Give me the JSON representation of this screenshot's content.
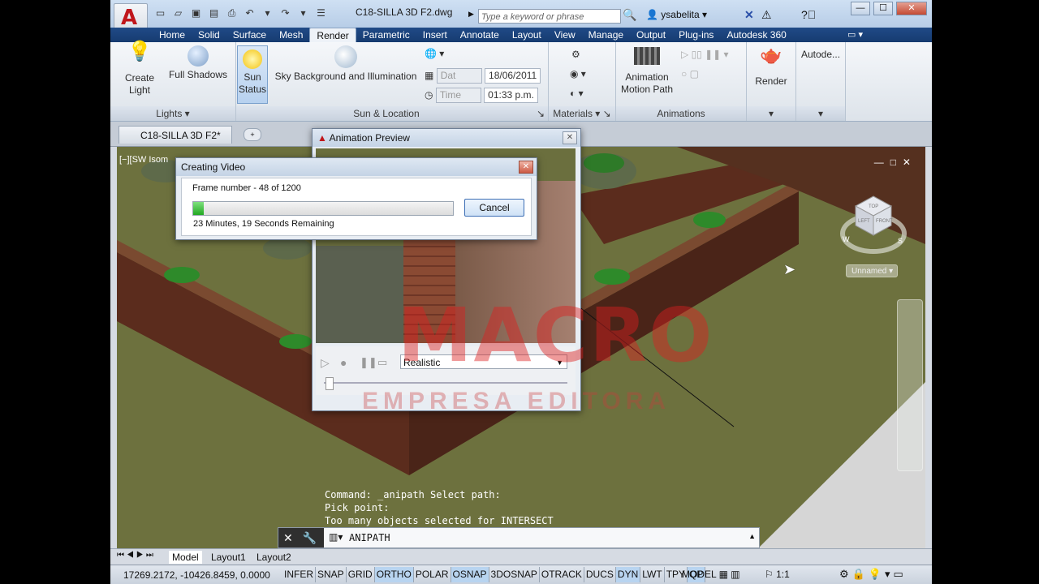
{
  "window": {
    "doc_title": "C18-SILLA 3D F2.dwg",
    "search_placeholder": "Type a keyword or phrase",
    "user": "ysabelita",
    "min": "—",
    "max": "☐",
    "close": "✕"
  },
  "ribbon_tabs": [
    "Home",
    "Solid",
    "Surface",
    "Mesh",
    "Render",
    "Parametric",
    "Insert",
    "Annotate",
    "Layout",
    "View",
    "Manage",
    "Output",
    "Plug-ins",
    "Autodesk 360"
  ],
  "active_tab": "Render",
  "ribbon": {
    "lights": {
      "create_light": "Create\nLight",
      "full_shadows": "Full Shadows",
      "label": "Lights"
    },
    "sun": {
      "sun_status": "Sun\nStatus",
      "sky": "Sky Background and Illumination",
      "date_label": "Dat",
      "date_value": "18/06/2011",
      "time_label": "Time",
      "time_value": "01:33 p.m.",
      "label": "Sun & Location"
    },
    "materials": {
      "label": "Materials"
    },
    "animations": {
      "motion_path": "Animation\nMotion Path",
      "label": "Animations"
    },
    "render": {
      "render": "Render",
      "autodesk": "Autode..."
    }
  },
  "doc_tab": {
    "name": "C18-SILLA 3D F2*"
  },
  "viewport": {
    "label": "[−][SW Isom",
    "view_name": "Unnamed"
  },
  "viewcube": {
    "top": "TOP",
    "left": "LEFT",
    "front": "FRONT",
    "w": "W",
    "s": "S"
  },
  "command_history": [
    "Command: _anipath Select path:",
    "Pick point:",
    "Too many objects selected for INTERSECT"
  ],
  "command_input": "ANIPATH",
  "layout_tabs": [
    "Model",
    "Layout1",
    "Layout2"
  ],
  "status": {
    "coords": "17269.2172, -10426.8459, 0.0000",
    "toggles": [
      "INFER",
      "SNAP",
      "GRID",
      "ORTHO",
      "POLAR",
      "OSNAP",
      "3DOSNAP",
      "OTRACK",
      "DUCS",
      "DYN",
      "LWT",
      "TPY",
      "QP"
    ],
    "toggles_on": [
      "ORTHO",
      "OSNAP",
      "DYN",
      "QP"
    ],
    "model": "MODEL",
    "scale": "1:1"
  },
  "animation_preview": {
    "title": "Animation Preview",
    "visual_style": "Realistic"
  },
  "creating_video": {
    "title": "Creating Video",
    "frame_text": "Frame number - 48 of 1200",
    "progress": 0.04,
    "remaining": "23 Minutes, 19 Seconds Remaining",
    "cancel": "Cancel"
  },
  "watermark": {
    "main": "MACRO",
    "sub": "EMPRESA EDITORA"
  }
}
